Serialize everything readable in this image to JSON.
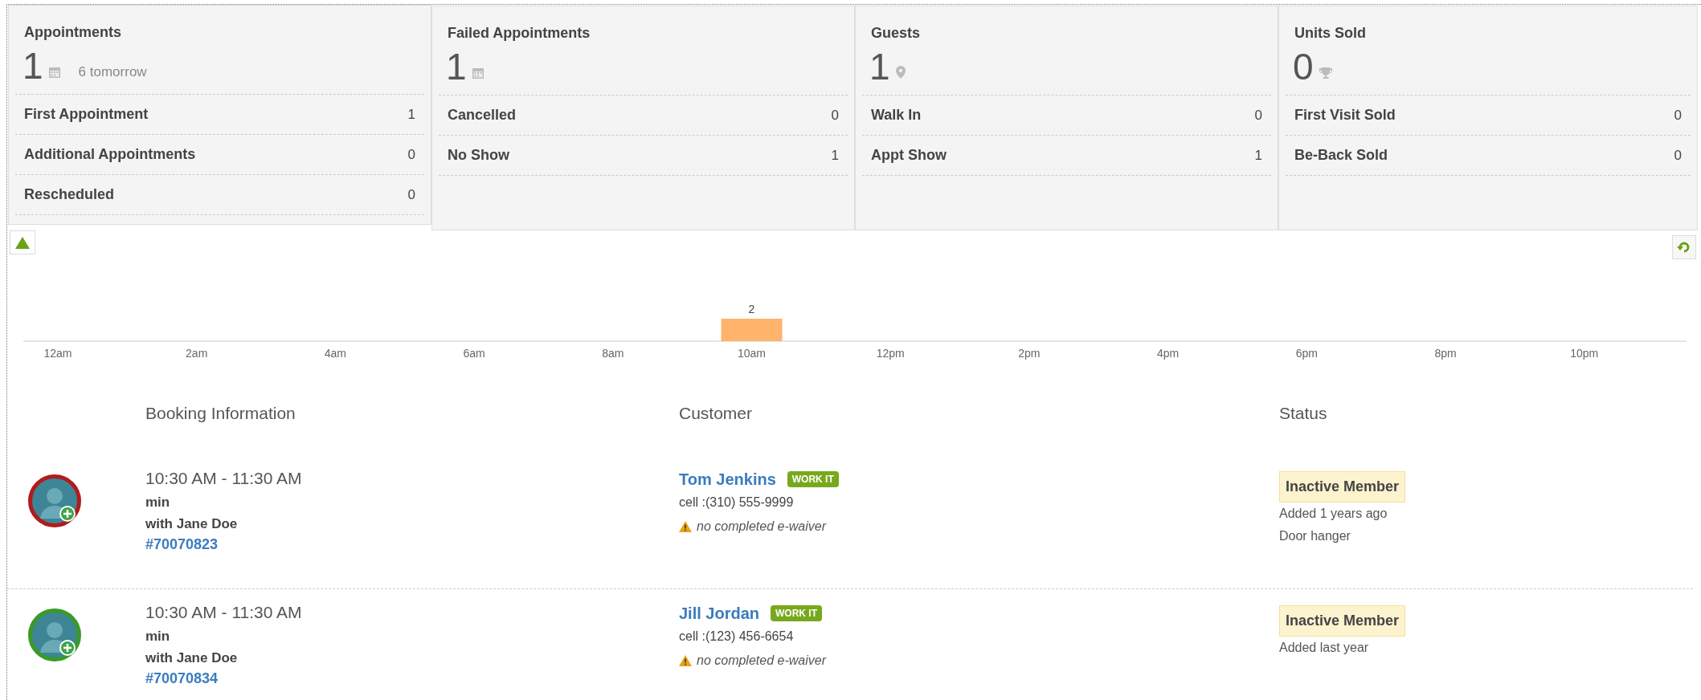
{
  "stat_cards": [
    {
      "title": "Appointments",
      "total": "1",
      "note": "6 tomorrow",
      "rows": [
        {
          "label": "First Appointment",
          "value": "1"
        },
        {
          "label": "Additional Appointments",
          "value": "0"
        },
        {
          "label": "Rescheduled",
          "value": "0"
        }
      ]
    },
    {
      "title": "Failed Appointments",
      "total": "1",
      "rows": [
        {
          "label": "Cancelled",
          "value": "0"
        },
        {
          "label": "No Show",
          "value": "1"
        }
      ]
    },
    {
      "title": "Guests",
      "total": "1",
      "rows": [
        {
          "label": "Walk In",
          "value": "0"
        },
        {
          "label": "Appt Show",
          "value": "1"
        }
      ]
    },
    {
      "title": "Units Sold",
      "total": "0",
      "rows": [
        {
          "label": "First Visit Sold",
          "value": "0"
        },
        {
          "label": "Be-Back Sold",
          "value": "0"
        }
      ]
    }
  ],
  "chart": {
    "chart_data": {
      "type": "bar",
      "categories": [
        "12am",
        "2am",
        "4am",
        "6am",
        "8am",
        "10am",
        "12pm",
        "2pm",
        "4pm",
        "6pm",
        "8pm",
        "10pm"
      ],
      "values": [
        0,
        0,
        0,
        0,
        0,
        2,
        0,
        0,
        0,
        0,
        0,
        0
      ],
      "value_labels": [
        null,
        null,
        null,
        null,
        null,
        "2",
        null,
        null,
        null,
        null,
        null,
        null
      ]
    }
  },
  "bookings": {
    "columns": [
      "Booking Information",
      "Customer",
      "Status"
    ],
    "rows": [
      {
        "color": "#b01c1c",
        "time": "10:30 AM - 11:30 AM",
        "duration": "min",
        "staff": "with Jane Doe",
        "booking_id": "#70070823",
        "customer": "Tom Jenkins",
        "badge": "WORK IT",
        "phone": "cell :(310) 555-9999",
        "warning": "no completed e-waiver",
        "status": "Inactive Member",
        "notes": [
          "Added 1 years ago",
          "Door hanger"
        ]
      },
      {
        "color": "#3a9a28",
        "time": "10:30 AM - 11:30 AM",
        "duration": "min",
        "staff": "with Jane Doe",
        "booking_id": "#70070834",
        "customer": "Jill Jordan",
        "badge": "WORK IT",
        "phone": "cell :(123) 456-6654",
        "warning": "no completed e-waiver",
        "status": "Inactive Member",
        "notes": [
          "Added last year"
        ]
      }
    ]
  }
}
